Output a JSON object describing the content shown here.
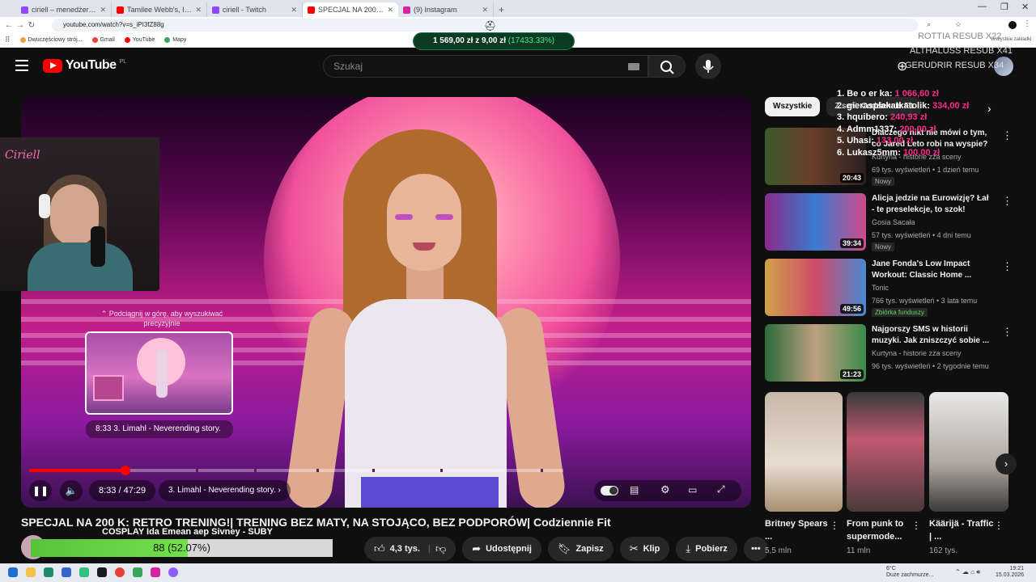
{
  "browser": {
    "tabs": [
      {
        "label": "ciriell – menedżer klipów – Twitch",
        "color": "#9146ff"
      },
      {
        "label": "Tamilee Webb's, I Want tha",
        "color": "#ff0000"
      },
      {
        "label": "ciriell - Twitch",
        "color": "#9146ff"
      },
      {
        "label": "SPECJAL NA 200 K: RETRO",
        "color": "#ff0000"
      },
      {
        "label": "(9) Instagram",
        "color": "#d6249f"
      }
    ],
    "new_tab": "+",
    "url": "youtube.com/watch?v=s_iPI3fZ88g",
    "bookmarks": [
      {
        "label": "Dwuczęściowy strój...",
        "color": "#e8a33d"
      },
      {
        "label": "Gmail",
        "color": "#ea4335"
      },
      {
        "label": "YouTube",
        "color": "#ff0000"
      },
      {
        "label": "Mapy",
        "color": "#34a853"
      }
    ],
    "bookmarks_right": "Wszystkie zakładki"
  },
  "donation": {
    "amount": "1 569,00 zł z 9,00 zł",
    "pct": "(17433.33%)"
  },
  "youtube": {
    "logo": "YouTube",
    "country": "PL",
    "search_placeholder": "Szukaj"
  },
  "stream_overlay": {
    "resubs": [
      "ROTTIA RESUB X22",
      "ALTHALUSS RESUB X41",
      "GERUDRIR RESUB X34"
    ],
    "top_donors": [
      {
        "rank": "1. Be o er ka:",
        "amount": "1 066,60 zł"
      },
      {
        "rank": "2. gierasplakatkatolik:",
        "amount": "334,00 zł"
      },
      {
        "rank": "3. hquibero:",
        "amount": "240,93 zł"
      },
      {
        "rank": "4. Admm1337:",
        "amount": "200,00 zł"
      },
      {
        "rank": "5. Uhasi:",
        "amount": "133,00 zł"
      },
      {
        "rank": "6. Lukasz5mm:",
        "amount": "100,00 zł"
      }
    ],
    "webcam_neon": "Ciriell"
  },
  "player": {
    "seek_hint": "Podciągnij w górę, aby wyszukiwać precyzyjnie",
    "seek_label": "8:33  3. Limahl - Neverending story.",
    "time": "8:33 / 47:29",
    "chapter": "3. Limahl - Neverending story.",
    "progress": 0.18
  },
  "video": {
    "title": "SPECJAL NA 200 K: RETRO TRENING!| TRENING BEZ MATY, NA STOJĄCO, BEZ PODPORÓW| Codziennie Fit"
  },
  "sub_goal": {
    "label": "COSPLAY Ida Emean aep Sivney - SUBY",
    "text": "88 (52.07%)",
    "fraction": 0.5207
  },
  "actions": {
    "likes": "4,3 tys.",
    "share": "Udostępnij",
    "save": "Zapisz",
    "clip": "Klip",
    "download": "Pobierz"
  },
  "sidebar": {
    "chips": [
      "Wszystkie",
      "Z serii: Codziennie Fit"
    ],
    "recommendations": [
      {
        "title": "Dlaczego nikt nie mówi o tym, co Jared Leto robi na wyspie?",
        "channel": "Kurtyna - historie zza sceny",
        "meta": "69 tys. wyświetleń • 1 dzień temu",
        "badge": "Nowy",
        "duration": "20:43"
      },
      {
        "title": "Alicja jedzie na Eurowizję? Łał - te preselekcje, to szok!",
        "channel": "Gosia Sacała",
        "meta": "57 tys. wyświetleń • 4 dni temu",
        "badge": "Nowy",
        "duration": "39:34"
      },
      {
        "title": "Jane Fonda's Low Impact Workout: Classic Home ...",
        "channel": "Tonic",
        "meta": "766 tys. wyświetleń • 3 lata temu",
        "badge": "Zbiórka funduszy",
        "duration": "49:56"
      },
      {
        "title": "Najgorszy SMS w historii muzyki. Jak zniszczyć sobie ...",
        "channel": "Kurtyna - historie zza sceny",
        "meta": "96 tys. wyświetleń • 2 tygodnie temu",
        "badge": "",
        "duration": "21:23"
      }
    ],
    "shorts": [
      {
        "title": "Britney Spears ...",
        "views": "5,5 mln"
      },
      {
        "title": "From punk to supermode...",
        "views": "11 mln"
      },
      {
        "title": "Käärijä - Traffic | ...",
        "views": "162 tys."
      }
    ]
  },
  "taskbar": {
    "weather_temp": "6°C",
    "weather_desc": "Duże zachmurze...",
    "time": "19:21",
    "date": "15.03.2026"
  }
}
